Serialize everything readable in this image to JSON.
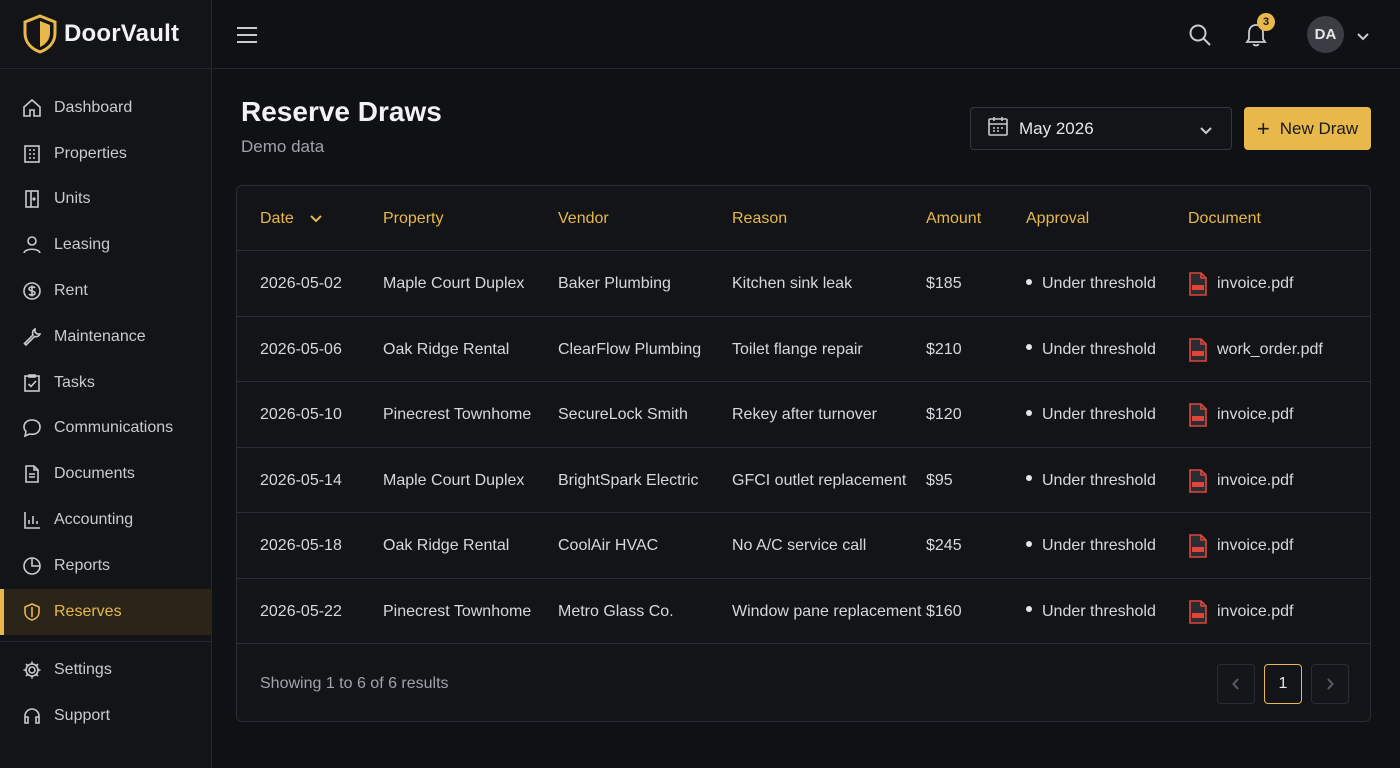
{
  "brand": {
    "name": "DoorVault"
  },
  "sidebar": {
    "items": [
      {
        "label": "Dashboard",
        "icon": "home-icon"
      },
      {
        "label": "Properties",
        "icon": "building-icon"
      },
      {
        "label": "Units",
        "icon": "door-icon"
      },
      {
        "label": "Leasing",
        "icon": "user-icon"
      },
      {
        "label": "Rent",
        "icon": "dollar-icon"
      },
      {
        "label": "Maintenance",
        "icon": "wrench-icon"
      },
      {
        "label": "Tasks",
        "icon": "clipboard-check-icon"
      },
      {
        "label": "Communications",
        "icon": "chat-icon"
      },
      {
        "label": "Documents",
        "icon": "document-icon"
      },
      {
        "label": "Accounting",
        "icon": "bar-chart-icon"
      },
      {
        "label": "Reports",
        "icon": "pie-chart-icon"
      },
      {
        "label": "Reserves",
        "icon": "shield-icon",
        "active": true
      }
    ],
    "bottom_items": [
      {
        "label": "Settings",
        "icon": "gear-icon"
      },
      {
        "label": "Support",
        "icon": "headset-icon"
      }
    ]
  },
  "topbar": {
    "notifications_count": "3",
    "avatar_initials": "DA"
  },
  "page": {
    "title": "Reserve Draws",
    "subtitle": "Demo data",
    "month_filter": "May 2026",
    "new_button": "New Draw"
  },
  "table": {
    "columns": [
      "Date",
      "Property",
      "Vendor",
      "Reason",
      "Amount",
      "Approval",
      "Document"
    ],
    "rows": [
      {
        "date": "2026-05-02",
        "property": "Maple Court Duplex",
        "vendor": "Baker Plumbing",
        "reason": "Kitchen sink leak",
        "amount": "$185",
        "approval": "Under threshold",
        "document": "invoice.pdf"
      },
      {
        "date": "2026-05-06",
        "property": "Oak Ridge Rental",
        "vendor": "ClearFlow Plumbing",
        "reason": "Toilet flange repair",
        "amount": "$210",
        "approval": "Under threshold",
        "document": "work_order.pdf"
      },
      {
        "date": "2026-05-10",
        "property": "Pinecrest Townhome",
        "vendor": "SecureLock Smith",
        "reason": "Rekey after turnover",
        "amount": "$120",
        "approval": "Under threshold",
        "document": "invoice.pdf"
      },
      {
        "date": "2026-05-14",
        "property": "Maple Court Duplex",
        "vendor": "BrightSpark Electric",
        "reason": "GFCI outlet replacement",
        "amount": "$95",
        "approval": "Under threshold",
        "document": "invoice.pdf"
      },
      {
        "date": "2026-05-18",
        "property": "Oak Ridge Rental",
        "vendor": "CoolAir HVAC",
        "reason": "No A/C service call",
        "amount": "$245",
        "approval": "Under threshold",
        "document": "invoice.pdf"
      },
      {
        "date": "2026-05-22",
        "property": "Pinecrest Townhome",
        "vendor": "Metro Glass Co.",
        "reason": "Window pane replacement",
        "amount": "$160",
        "approval": "Under threshold",
        "document": "invoice.pdf"
      }
    ],
    "footer_text": "Showing 1 to 6 of 6 results",
    "current_page": "1"
  },
  "colors": {
    "accent": "#e8b84a",
    "background": "#0f1114",
    "panel": "#121418",
    "border": "#2a2d33"
  }
}
